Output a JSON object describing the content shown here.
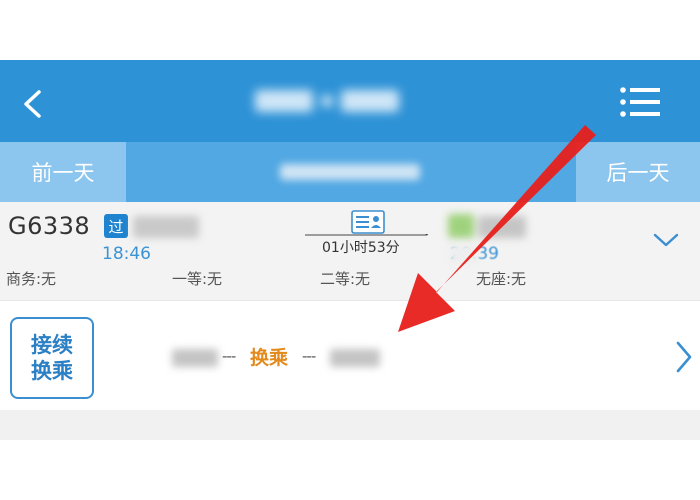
{
  "header": {
    "title": "",
    "back_icon": "chevron-left-icon",
    "menu_icon": "menu-icon"
  },
  "daybar": {
    "prev_label": "前一天",
    "next_label": "后一天",
    "date": ""
  },
  "train": {
    "number": "G6338",
    "pass_badge": "过",
    "departure_station": "",
    "departure_time": "18:46",
    "duration": "01小时53分",
    "arrival_station": "",
    "arrival_time": "20:39",
    "seats": [
      {
        "label": "商务:无"
      },
      {
        "label": "一等:无"
      },
      {
        "label": "二等:无"
      },
      {
        "label": "无座:无"
      }
    ]
  },
  "transfer": {
    "box_line1": "接续",
    "box_line2": "换乘",
    "from_station": "",
    "separator": "---",
    "label": "换乘",
    "to_station": ""
  },
  "colors": {
    "header_bg": "#2e92d6",
    "daybar_bg": "#52a8e3",
    "accent_blue": "#3b93d4",
    "transfer_orange": "#e28a1c",
    "annotation_red": "#e8201c"
  }
}
